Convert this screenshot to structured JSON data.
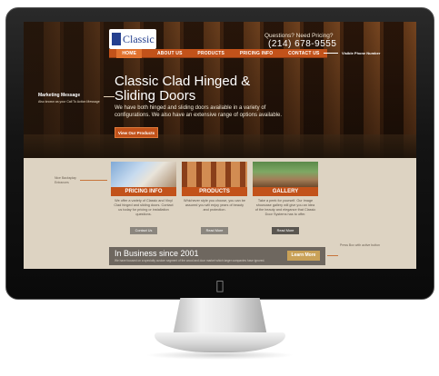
{
  "site": {
    "logo_text": "Classic",
    "phone_label": "Questions? Need Pricing?",
    "phone_number": "(214) 678-9555",
    "nav": [
      "HOME",
      "ABOUT US",
      "PRODUCTS",
      "PRICING INFO",
      "CONTACT US"
    ],
    "hero": {
      "title": "Classic Clad Hinged & Sliding Doors",
      "description": "We have both hinged and sliding doors available in a variety of configurations. We also have an extensive range of options available.",
      "button": "View Our Products"
    },
    "cards": [
      {
        "title": "PRICING INFO",
        "text": "We offer a variety of Classic and Vinyl Clad hinged and sliding doors. Contact us today for pricing or installation questions.",
        "button": "Contact Us"
      },
      {
        "title": "PRODUCTS",
        "text": "Whichever style you choose, you can be assured you will enjoy years of beauty and protection.",
        "button": "Read More"
      },
      {
        "title": "GALLERY",
        "text": "Take a peek for yourself. Our image showcase gallery will give you an idea of the beauty and elegance that Classic Door Systems has to offer.",
        "button": "Read More"
      }
    ],
    "business": {
      "title": "In Business since 2001",
      "description": "We have focused on a specialty custom segment of the wood and door market which larger companies have ignored.",
      "button": "Learn More"
    }
  },
  "annotations": {
    "phone": "Visible Phone Number",
    "marketing_title": "Marketing Message",
    "marketing_sub": "Also known as your Call To Action Message",
    "bay": "Nice Backsplay Entrances",
    "press": "Press Box with active button"
  },
  "icons": [
    "apple-logo-icon"
  ]
}
